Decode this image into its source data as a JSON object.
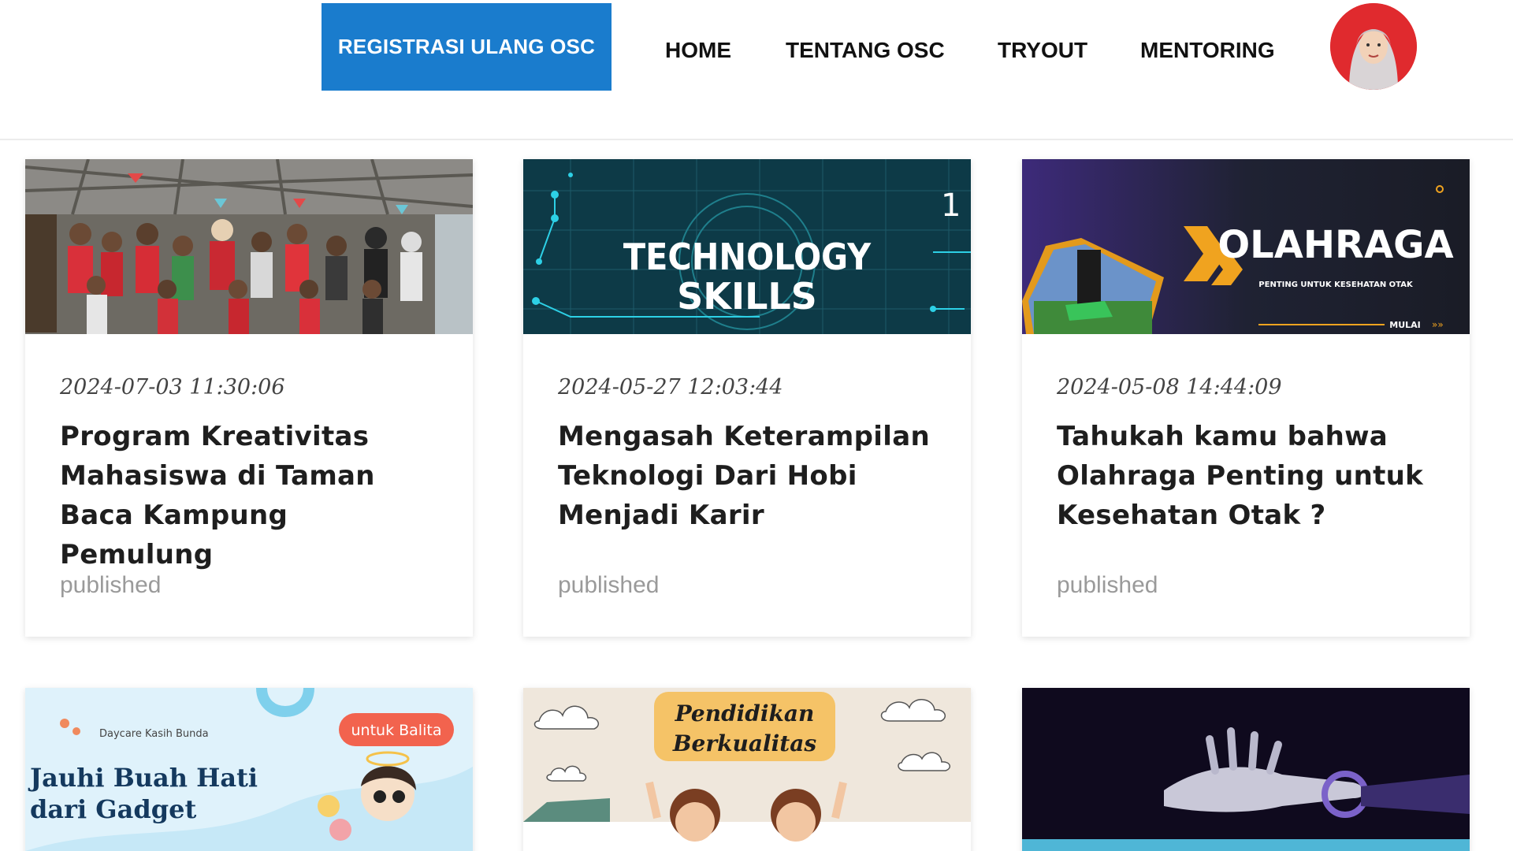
{
  "header": {
    "register_button": "REGISTRASI ULANG OSC",
    "nav": [
      "HOME",
      "TENTANG OSC",
      "TRYOUT",
      "MENTORING"
    ],
    "accent_color": "#1a7ccd"
  },
  "articles": [
    {
      "date": "2024-07-03 11:30:06",
      "title": "Program Kreativitas Mahasiswa di Taman Baca Kampung Pemulung",
      "status": "published",
      "image": "group-photo-children"
    },
    {
      "date": "2024-05-27 12:03:44",
      "title": "Mengasah Keterampilan Teknologi Dari Hobi Menjadi Karir",
      "status": "published",
      "image": "technology-skills-banner",
      "image_text": [
        "TECHNOLOGY",
        "SKILLS",
        "1"
      ]
    },
    {
      "date": "2024-05-08 14:44:09",
      "title": "Tahukah kamu bahwa Olahraga Penting untuk Kesehatan Otak ?",
      "status": "published",
      "image": "olahraga-banner",
      "image_text": [
        "OLAHRAGA",
        "PENTING UNTUK KESEHATAN OTAK",
        "MULAI"
      ]
    }
  ],
  "articles_row2": [
    {
      "image": "daycare-banner",
      "image_text": [
        "Daycare Kasih Bunda",
        "untuk Balita",
        "Jauhi Buah Hati",
        "dari Gadget"
      ]
    },
    {
      "image": "pendidikan-banner",
      "image_text": [
        "Pendidikan",
        "Berkualitas"
      ]
    },
    {
      "image": "robot-hand-image"
    }
  ]
}
